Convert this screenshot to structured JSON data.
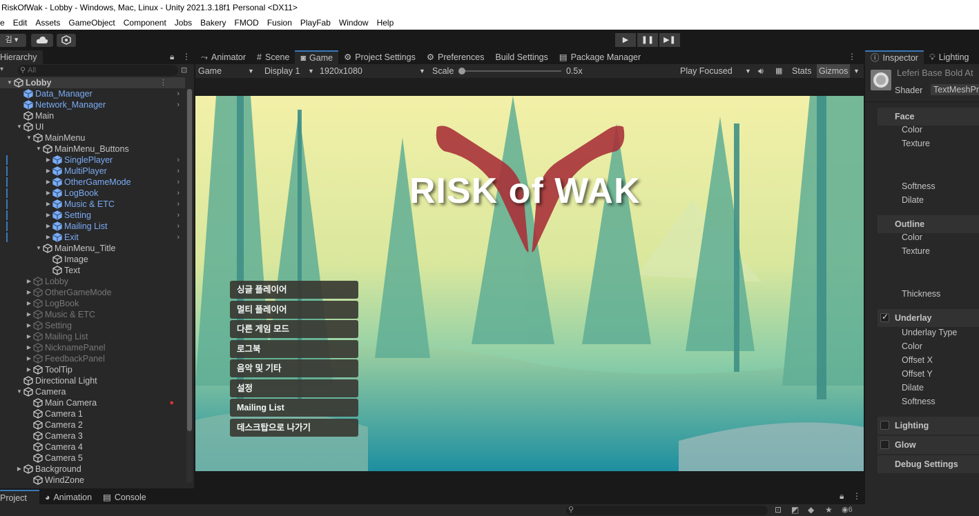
{
  "window": {
    "title": "RiskOfWak - Lobby - Windows, Mac, Linux - Unity 2021.3.18f1 Personal <DX11>"
  },
  "menu": [
    "e",
    "Edit",
    "Assets",
    "GameObject",
    "Component",
    "Jobs",
    "Bakery",
    "FMOD",
    "Fusion",
    "PlayFab",
    "Window",
    "Help"
  ],
  "toolbar": {
    "account": "김 ▾",
    "cloud_icon": "cloud-icon",
    "collab_icon": "collab-icon"
  },
  "play_controls": {
    "play": "▶",
    "pause": "❚❚",
    "step": "▶❚"
  },
  "hierarchy": {
    "tab": "Hierarchy",
    "search_placeholder": "All",
    "rows": [
      {
        "label": "Lobby",
        "style": "root",
        "has_arrow": true
      },
      {
        "label": "Data_Manager",
        "style": "blue",
        "has_arrow": false
      },
      {
        "label": "Network_Manager",
        "style": "blue",
        "has_arrow": false
      },
      {
        "label": "Main",
        "style": "normal",
        "has_arrow": false
      },
      {
        "label": "UI",
        "style": "normal",
        "has_arrow": true
      },
      {
        "label": "MainMenu",
        "style": "normal",
        "has_arrow": true
      },
      {
        "label": "MainMenu_Buttons",
        "style": "normal",
        "has_arrow": true
      },
      {
        "label": "SinglePlayer",
        "style": "blue",
        "has_arrow": true
      },
      {
        "label": "MultiPlayer",
        "style": "blue",
        "has_arrow": true
      },
      {
        "label": "OtherGameMode",
        "style": "blue",
        "has_arrow": true
      },
      {
        "label": "LogBook",
        "style": "blue",
        "has_arrow": true
      },
      {
        "label": "Music & ETC",
        "style": "blue",
        "has_arrow": true
      },
      {
        "label": "Setting",
        "style": "blue",
        "has_arrow": true
      },
      {
        "label": "Mailing List",
        "style": "blue",
        "has_arrow": true
      },
      {
        "label": "Exit",
        "style": "blue",
        "has_arrow": true
      },
      {
        "label": "MainMenu_Title",
        "style": "normal",
        "has_arrow": true
      },
      {
        "label": "Image",
        "style": "normal",
        "has_arrow": false
      },
      {
        "label": "Text",
        "style": "normal",
        "has_arrow": false
      },
      {
        "label": "Lobby",
        "style": "dim",
        "has_arrow": true
      },
      {
        "label": "OtherGameMode",
        "style": "dim",
        "has_arrow": true
      },
      {
        "label": "LogBook",
        "style": "dim",
        "has_arrow": true
      },
      {
        "label": "Music & ETC",
        "style": "dim",
        "has_arrow": true
      },
      {
        "label": "Setting",
        "style": "dim",
        "has_arrow": true
      },
      {
        "label": "Mailing List",
        "style": "dim",
        "has_arrow": true
      },
      {
        "label": "NicknamePanel",
        "style": "dim",
        "has_arrow": true
      },
      {
        "label": "FeedbackPanel",
        "style": "dim",
        "has_arrow": true
      },
      {
        "label": "ToolTip",
        "style": "normal",
        "has_arrow": true
      },
      {
        "label": "Directional Light",
        "style": "normal",
        "has_arrow": false
      },
      {
        "label": "Camera",
        "style": "normal",
        "has_arrow": true
      },
      {
        "label": "Main Camera",
        "style": "normal",
        "has_arrow": false
      },
      {
        "label": "Camera 1",
        "style": "normal",
        "has_arrow": false
      },
      {
        "label": "Camera 2",
        "style": "normal",
        "has_arrow": false
      },
      {
        "label": "Camera 3",
        "style": "normal",
        "has_arrow": false
      },
      {
        "label": "Camera 4",
        "style": "normal",
        "has_arrow": false
      },
      {
        "label": "Camera 5",
        "style": "normal",
        "has_arrow": false
      },
      {
        "label": "Background",
        "style": "normal",
        "has_arrow": true
      },
      {
        "label": "WindZone",
        "style": "normal",
        "has_arrow": false
      }
    ]
  },
  "center_tabs": [
    {
      "label": "Animator",
      "icon": "animator-icon"
    },
    {
      "label": "Scene",
      "icon": "scene-icon"
    },
    {
      "label": "Game",
      "icon": "game-icon",
      "active": true
    },
    {
      "label": "Project Settings",
      "icon": "gear-icon"
    },
    {
      "label": "Preferences",
      "icon": "gear-icon"
    },
    {
      "label": "Build Settings",
      "icon": ""
    },
    {
      "label": "Package Manager",
      "icon": "package-icon"
    }
  ],
  "game_bar": {
    "mode": "Game",
    "display": "Display 1",
    "resolution": "1920x1080",
    "scale_label": "Scale",
    "scale_value": "0.5x",
    "play_focus": "Play Focused",
    "stats": "Stats",
    "gizmos": "Gizmos"
  },
  "game": {
    "title": "RISK of WAK",
    "buttons": [
      "싱글 플레이어",
      "멀티 플레이어",
      "다른 게임 모드",
      "로그북",
      "음악 및 기타",
      "설정",
      "Mailing List",
      "데스크탑으로 나가기"
    ]
  },
  "inspector": {
    "tabs": [
      {
        "label": "Inspector",
        "icon": "info-icon"
      },
      {
        "label": "Lighting",
        "icon": "bulb-icon"
      }
    ],
    "material_name": "Leferi Base Bold At",
    "shader_label": "Shader",
    "shader_value": "TextMeshPr",
    "face": {
      "header": "Face",
      "props": [
        "Color",
        "Texture",
        "Softness",
        "Dilate"
      ]
    },
    "outline": {
      "header": "Outline",
      "props": [
        "Color",
        "Texture",
        "Thickness"
      ]
    },
    "underlay": {
      "header": "Underlay",
      "checked": true,
      "props": [
        "Underlay Type",
        "Color",
        "Offset X",
        "Offset Y",
        "Dilate",
        "Softness"
      ]
    },
    "lighting": {
      "header": "Lighting",
      "checked": false
    },
    "glow": {
      "header": "Glow",
      "checked": false
    },
    "debug": {
      "header": "Debug Settings"
    }
  },
  "bottom_tabs": [
    {
      "label": "Project",
      "icon": ""
    },
    {
      "label": "Animation",
      "icon": "animation-icon"
    },
    {
      "label": "Console",
      "icon": "console-icon"
    }
  ],
  "bottom_status": {
    "hidden_count": "6"
  }
}
